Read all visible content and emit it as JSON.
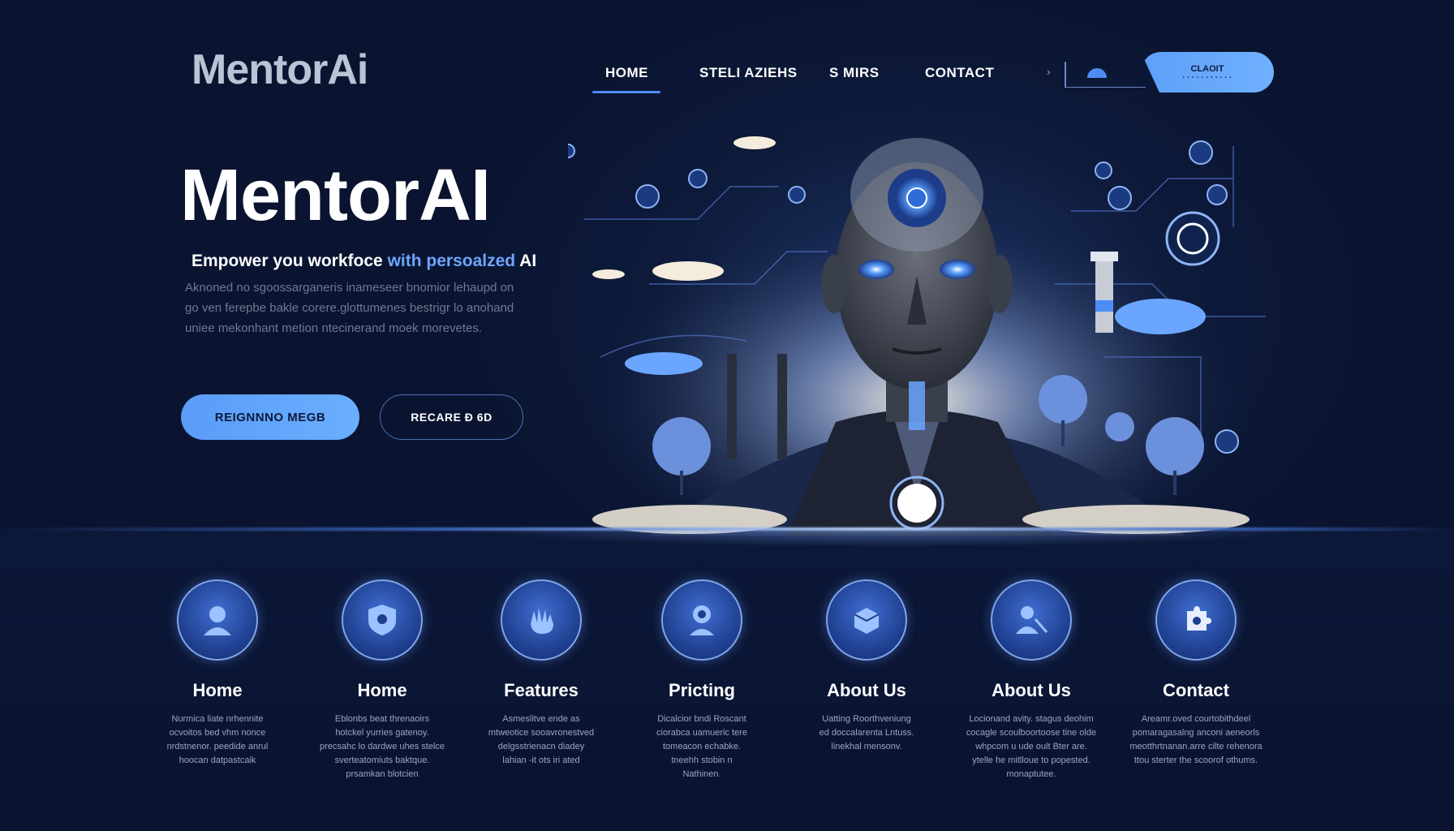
{
  "brand": {
    "logo": "MentorAi"
  },
  "nav": {
    "items": [
      "HOME",
      "STELI AZIEHS",
      "S MIRS",
      "CONTACT"
    ],
    "cta_label": "CLAOIT",
    "cta_dots": "• • • • • • • • • • •"
  },
  "hero": {
    "title": "MentorAI",
    "subtitle_start": "Empower you workfoce ",
    "subtitle_highlight": "with persoalzed",
    "subtitle_end": " AI",
    "description": "Aknoned no sgoossarganeris inameseer bnomior lehaupd on go ven ferepbe bakle corere.glottumenes bestrigr lo anohand uniee mekonhant metion ntecinerand moek morevetes.",
    "primary_button": "REIGNNNO MEGB",
    "secondary_button": "RECARE Ð 6D"
  },
  "features": [
    {
      "title": "Home",
      "icon": "person-icon",
      "lines": [
        "Nurmica liate nrhennite",
        "ocvoitos bed vhm nonce",
        "nrdstnenor. peedide anrul",
        "hoocan datpastcaik"
      ]
    },
    {
      "title": "Home",
      "icon": "shield-icon",
      "lines": [
        "Eblonbs beat threnaoirs",
        "hotckel yurries gatenoy.",
        "precsahc lo dardwe uhes stelce",
        "sverteatomiuts baktque.",
        "prsamkan blotcien"
      ]
    },
    {
      "title": "Features",
      "icon": "hand-icon",
      "lines": [
        "Asmeslitve ende as",
        "mtweotice sooavronestved",
        "delgsstrienacn diadey",
        "lahian -it ots iri ated"
      ]
    },
    {
      "title": "Pricting",
      "icon": "robot-icon",
      "lines": [
        "Dicalcior bndi Roscant",
        "ciorabca uamueric tere",
        "tomeacon echabke.",
        "tneehh stobin n",
        "Nathinen."
      ]
    },
    {
      "title": "About Us",
      "icon": "box-icon",
      "lines": [
        "Uatting Roorthveniung",
        "ed doccalarenta Lntuss.",
        "linekhal mensonv."
      ]
    },
    {
      "title": "About Us",
      "icon": "user-tool-icon",
      "lines": [
        "Locionand avity. stagus deohim",
        "cocagle scoulboortoose tine olde",
        "whpcom u ude oult Bter are.",
        "ytelle he mitlloue to popested.",
        "monaptutee."
      ]
    },
    {
      "title": "Contact",
      "icon": "puzzle-icon",
      "lines": [
        "Areamr.oved courtobithdeel",
        "pomaragasalng anconi aeneorls",
        "meotthrtnanan.arre cilte rehenora",
        "ttou sterter the scoorof othums."
      ]
    }
  ],
  "colors": {
    "accent": "#5a9cf7",
    "background": "#0b1530",
    "text_muted": "#6d7a93"
  }
}
